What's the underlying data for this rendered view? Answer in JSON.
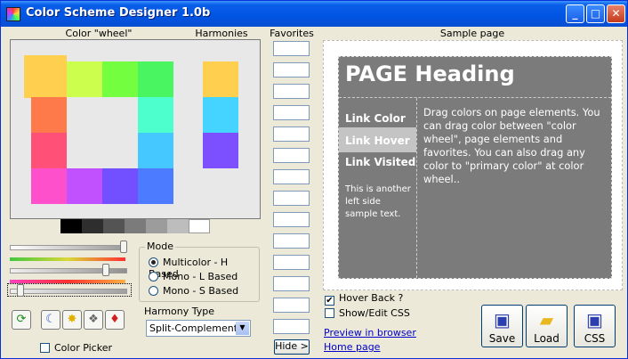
{
  "window": {
    "title": "Color Scheme Designer 1.0b"
  },
  "labels": {
    "color_wheel": "Color \"wheel\"",
    "harmonies": "Harmonies",
    "favorites": "Favorites",
    "sample_page": "Sample page"
  },
  "wheel_swatches": [
    "#ffd050",
    "#ccff4d",
    "#73ff40",
    "#49f561",
    "#ff7a4a",
    "#4dffcc",
    "#ff5078",
    "#45c8ff",
    "#ff50cc",
    "#c150ff",
    "#7250ff",
    "#4d7bff"
  ],
  "harmony_swatches": [
    "#ffd050",
    "#45d4ff",
    "#7c50ff"
  ],
  "grayscale": [
    "#000000",
    "#2e2e2e",
    "#545454",
    "#7b7b7b",
    "#9c9c9c",
    "#bdbdbd",
    "#ffffff"
  ],
  "mode": {
    "title": "Mode",
    "options": [
      "Multicolor - H Based",
      "Mono - L Based",
      "Mono - S Based"
    ],
    "selected": "Multicolor - H Based"
  },
  "harmony_type": {
    "title": "Harmony Type",
    "value": "Split-Complements"
  },
  "color_picker_label": "Color Picker",
  "hide_button": "Hide >",
  "sample": {
    "heading": "PAGE Heading",
    "link_color": "Link Color",
    "link_hover": "Link Hover",
    "link_visited": "Link Visited",
    "left_text": "This is another left side sample text.",
    "main_text": "Drag colors on page elements. You can drag color between \"color wheel\", page elements and favorites. You can also drag any color to \"primary color\" at color wheel.."
  },
  "options": {
    "hover_back": "Hover Back ?",
    "show_edit_css": "Show/Edit CSS"
  },
  "links": {
    "preview": "Preview in browser",
    "home": "Home page"
  },
  "buttons": {
    "save": "Save",
    "load": "Load",
    "css": "CSS"
  },
  "colors": {
    "title_bar": "#0054e3",
    "page_bg": "#7b7b7b",
    "hover_bg": "#c4c4c4"
  }
}
